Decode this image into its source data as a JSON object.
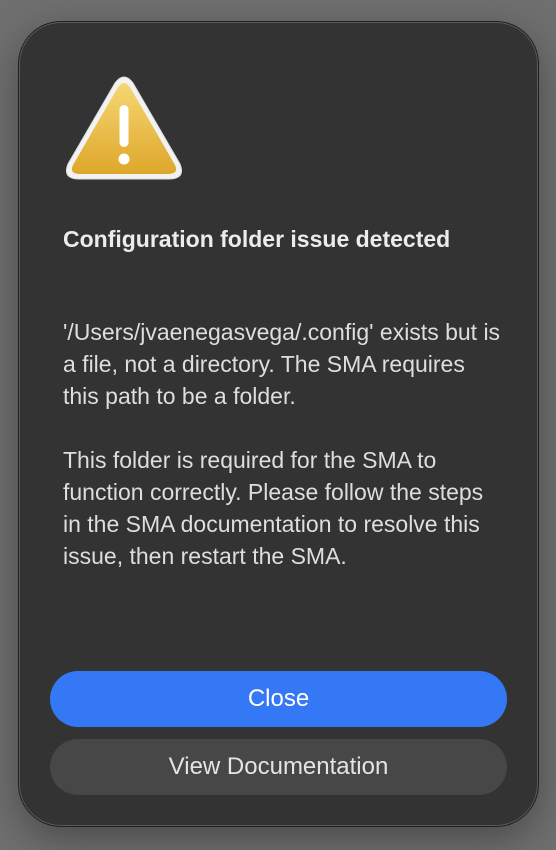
{
  "dialog": {
    "icon": "warning-triangle-icon",
    "title": "Configuration folder issue detected",
    "message": [
      "'/Users/jvaenegasvega/.config' exists but is a file, not a directory. The SMA requires this path to be a folder.",
      "This folder is required for the SMA to function correctly. Please follow the steps in the SMA documentation to resolve this issue, then restart the SMA."
    ],
    "buttons": {
      "primary_label": "Close",
      "secondary_label": "View Documentation"
    }
  },
  "colors": {
    "background": "#6f6f70",
    "dialog": "#333334",
    "primary_button": "#3478f6",
    "secondary_button": "#474748",
    "warning_fill": "#e8bb3c"
  }
}
